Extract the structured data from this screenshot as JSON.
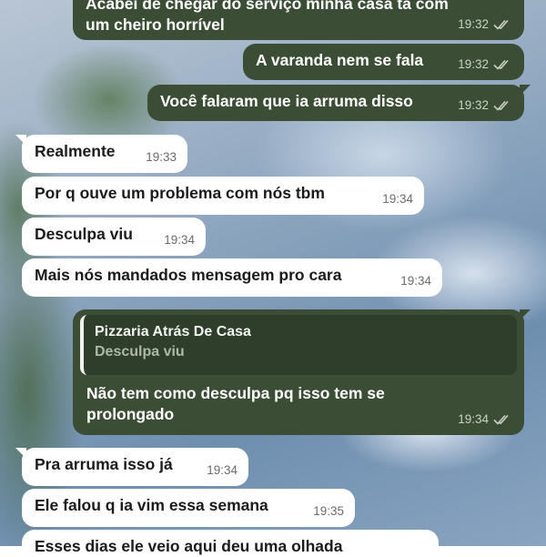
{
  "chat": {
    "messages": [
      {
        "dir": "out",
        "text": "Acabei de chegar do serviço minha casa tá com um cheiro horrível",
        "time": "19:32",
        "status": "read"
      },
      {
        "dir": "out",
        "text": "A varanda nem se fala",
        "time": "19:32",
        "status": "read"
      },
      {
        "dir": "out",
        "text": "Você falaram que ia arruma disso",
        "time": "19:32",
        "status": "read"
      },
      {
        "dir": "in",
        "text": "Realmente",
        "time": "19:33"
      },
      {
        "dir": "in",
        "text": "Por q ouve um problema com nós tbm",
        "time": "19:34"
      },
      {
        "dir": "in",
        "text": "Desculpa viu",
        "time": "19:34"
      },
      {
        "dir": "in",
        "text": "Mais nós mandados mensagem pro cara",
        "time": "19:34"
      },
      {
        "dir": "out",
        "text": "Não tem como desculpa pq isso tem se prolongado",
        "time": "19:34",
        "status": "read",
        "reply": {
          "name": "Pizzaria Atrás De Casa",
          "text": "Desculpa viu"
        }
      },
      {
        "dir": "in",
        "text": "Pra arruma isso já",
        "time": "19:34"
      },
      {
        "dir": "in",
        "text": "Ele falou q ia vim essa semana",
        "time": "19:35"
      },
      {
        "dir": "in",
        "text": "Esses dias ele veio aqui deu uma olhada",
        "time": ""
      }
    ]
  },
  "colors": {
    "outgoing_bubble": "#3c4d36",
    "incoming_bubble": "#ffffff",
    "read_ticks": "#c9d2c4"
  }
}
